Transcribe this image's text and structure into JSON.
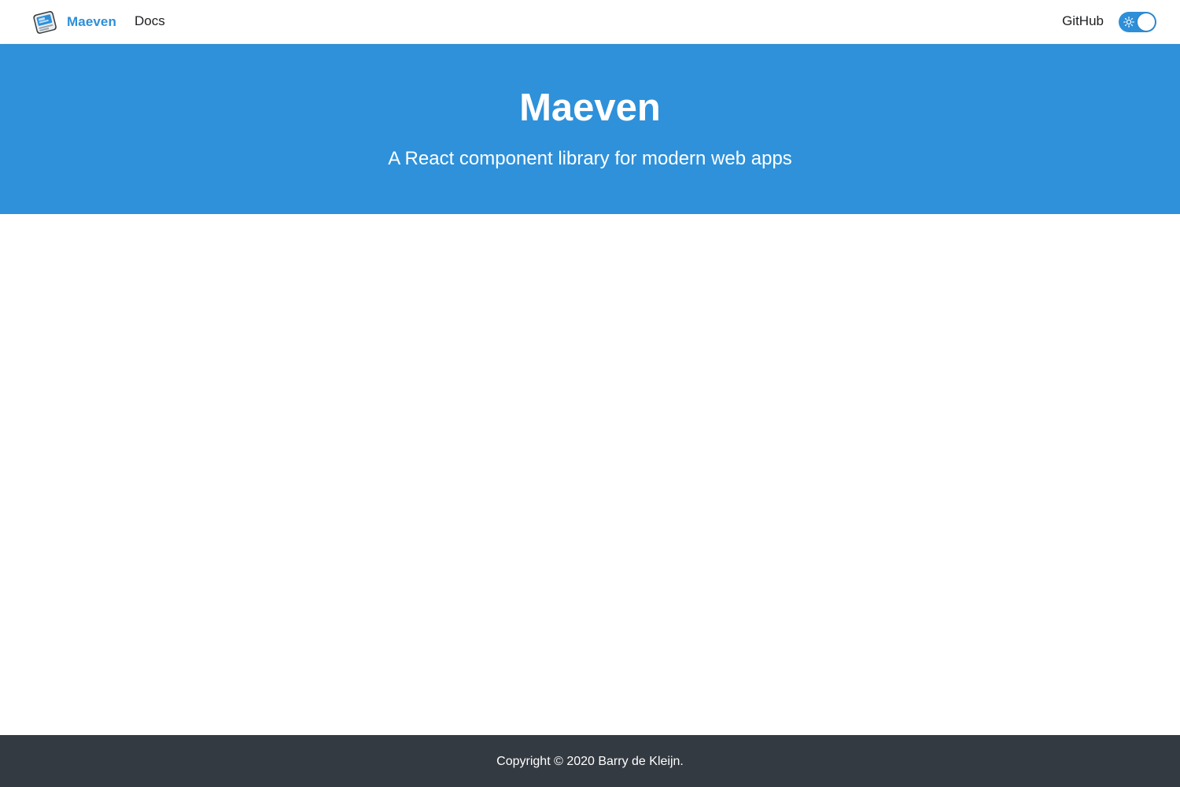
{
  "navbar": {
    "brand": {
      "title": "Maeven",
      "logo_icon": "maeven-logo-icon"
    },
    "links": [
      {
        "label": "Docs"
      }
    ],
    "right_links": [
      {
        "label": "GitHub"
      }
    ],
    "theme_toggle": {
      "icon": "sun-icon",
      "checked": true
    }
  },
  "hero": {
    "title": "Maeven",
    "subtitle": "A React component library for modern web apps"
  },
  "footer": {
    "copyright": "Copyright © 2020 Barry de Kleijn."
  },
  "colors": {
    "brand": "#2e8fd8",
    "hero_background": "#2e91da",
    "footer_background": "#343a42",
    "text": "#1c1e21"
  }
}
